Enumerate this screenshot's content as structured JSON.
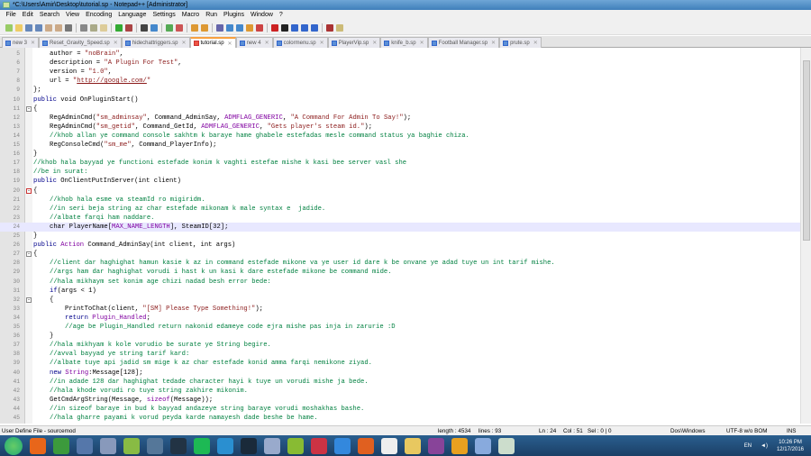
{
  "window": {
    "title": "*C:\\Users\\Amir\\Desktop\\tutorial.sp - Notepad++ [Administrator]"
  },
  "menu": [
    "File",
    "Edit",
    "Search",
    "View",
    "Encoding",
    "Language",
    "Settings",
    "Macro",
    "Run",
    "Plugins",
    "Window",
    "?"
  ],
  "tabs": [
    {
      "label": "new  3"
    },
    {
      "label": "Reset_Gravity_Speed.sp"
    },
    {
      "label": "hidechattriggers.sp"
    },
    {
      "label": "tutorial.sp",
      "active": true
    },
    {
      "label": "new  4"
    },
    {
      "label": "colormenu.sp"
    },
    {
      "label": "PlayerVip.sp"
    },
    {
      "label": "knife_b.sp"
    },
    {
      "label": "Football Manager.sp"
    },
    {
      "label": "prute.sp"
    }
  ],
  "lines": [
    {
      "n": "5",
      "i": 1,
      "seg": [
        [
          "t",
          "author = "
        ],
        [
          "s",
          "\"noBrain\""
        ],
        [
          "t",
          ","
        ]
      ]
    },
    {
      "n": "6",
      "i": 1,
      "seg": [
        [
          "t",
          "description = "
        ],
        [
          "s",
          "\"A Plugin For Test\""
        ],
        [
          "t",
          ","
        ]
      ]
    },
    {
      "n": "7",
      "i": 1,
      "seg": [
        [
          "t",
          "version = "
        ],
        [
          "s",
          "\"1.0\""
        ],
        [
          "t",
          ","
        ]
      ]
    },
    {
      "n": "8",
      "i": 1,
      "seg": [
        [
          "t",
          "url = "
        ],
        [
          "s",
          "\""
        ],
        [
          "u",
          "http://google.com/"
        ],
        [
          "s",
          "\""
        ]
      ]
    },
    {
      "n": "9",
      "i": 0,
      "seg": [
        [
          "t",
          "};"
        ]
      ]
    },
    {
      "n": "10",
      "i": 0,
      "seg": [
        [
          "k",
          "public"
        ],
        [
          "t",
          " void OnPluginStart()"
        ]
      ]
    },
    {
      "n": "11",
      "i": 0,
      "seg": [
        [
          "t",
          "{"
        ]
      ],
      "fold": "-"
    },
    {
      "n": "12",
      "i": 1,
      "seg": [
        [
          "t",
          "RegAdminCmd("
        ],
        [
          "s",
          "\"sm_adminsay\""
        ],
        [
          "t",
          ", Command_AdminSay, "
        ],
        [
          "m",
          "ADMFLAG_GENERIC"
        ],
        [
          "t",
          ", "
        ],
        [
          "s",
          "\"A Command For Admin To Say!\""
        ],
        [
          "t",
          ");"
        ]
      ]
    },
    {
      "n": "13",
      "i": 1,
      "seg": [
        [
          "t",
          "RegAdminCmd("
        ],
        [
          "s",
          "\"sm_getid\""
        ],
        [
          "t",
          ", Command_GetId, "
        ],
        [
          "m",
          "ADMFLAG_GENERIC"
        ],
        [
          "t",
          ", "
        ],
        [
          "s",
          "\"Gets player's steam id.\""
        ],
        [
          "t",
          ");"
        ]
      ]
    },
    {
      "n": "14",
      "i": 1,
      "seg": [
        [
          "c",
          "//khob allan ye command console sakhtm k baraye hame ghabele estefadas mesle command status ya baghie chiza."
        ]
      ]
    },
    {
      "n": "15",
      "i": 1,
      "seg": [
        [
          "t",
          "RegConsoleCmd("
        ],
        [
          "s",
          "\"sm_me\""
        ],
        [
          "t",
          ", Command_PlayerInfo);"
        ]
      ]
    },
    {
      "n": "16",
      "i": 0,
      "seg": [
        [
          "t",
          "}"
        ]
      ]
    },
    {
      "n": "17",
      "i": 0,
      "seg": [
        [
          "c",
          "//khob hala bayyad ye functioni estefade konim k vaghti estefae mishe k kasi bee server vasl she"
        ]
      ]
    },
    {
      "n": "18",
      "i": 0,
      "seg": [
        [
          "c",
          "//be in surat:"
        ]
      ]
    },
    {
      "n": "19",
      "i": 0,
      "seg": [
        [
          "k",
          "public"
        ],
        [
          "t",
          " OnClientPutInServer(int client)"
        ]
      ]
    },
    {
      "n": "20",
      "i": 0,
      "seg": [
        [
          "t",
          "{"
        ]
      ],
      "fold": "-r"
    },
    {
      "n": "21",
      "i": 1,
      "seg": [
        [
          "c",
          "//khob hala esme va steamId ro migiridm."
        ]
      ]
    },
    {
      "n": "22",
      "i": 1,
      "seg": [
        [
          "c",
          "//in seri beja string az char estefade mikonam k male syntax e  jadide."
        ]
      ]
    },
    {
      "n": "23",
      "i": 1,
      "seg": [
        [
          "c",
          "//albate farqi ham naddare."
        ]
      ]
    },
    {
      "n": "24",
      "i": 1,
      "cur": true,
      "seg": [
        [
          "t",
          "char PlayerName["
        ],
        [
          "m",
          "MAX_NAME_LENGTH"
        ],
        [
          "t",
          "], SteamID[32];"
        ]
      ]
    },
    {
      "n": "25",
      "i": 0,
      "seg": [
        [
          "t",
          "}"
        ]
      ]
    },
    {
      "n": "26",
      "i": 0,
      "seg": [
        [
          "k",
          "public"
        ],
        [
          "t",
          " "
        ],
        [
          "m",
          "Action"
        ],
        [
          "t",
          " Command_AdminSay(int client, int args)"
        ]
      ]
    },
    {
      "n": "27",
      "i": 0,
      "seg": [
        [
          "t",
          "{"
        ]
      ],
      "fold": "-"
    },
    {
      "n": "28",
      "i": 1,
      "seg": [
        [
          "c",
          "//client dar haghighat hamun kasie k az in command estefade mikone va ye user id dare k be onvane ye adad tuye un int tarif mishe."
        ]
      ]
    },
    {
      "n": "29",
      "i": 1,
      "seg": [
        [
          "c",
          "//args ham dar haghighat vorudi i hast k un kasi k dare estefade mikone be command mide."
        ]
      ]
    },
    {
      "n": "30",
      "i": 1,
      "seg": [
        [
          "c",
          "//hala mikhaym set konim age chizi nadad besh error bede:"
        ]
      ]
    },
    {
      "n": "31",
      "i": 1,
      "seg": [
        [
          "k",
          "if"
        ],
        [
          "t",
          "(args < 1)"
        ]
      ]
    },
    {
      "n": "32",
      "i": 1,
      "seg": [
        [
          "t",
          "{"
        ]
      ],
      "fold": "-"
    },
    {
      "n": "33",
      "i": 2,
      "seg": [
        [
          "t",
          "PrintToChat(client, "
        ],
        [
          "s",
          "\"[SM] Please Type Something!\""
        ],
        [
          "t",
          ");"
        ]
      ]
    },
    {
      "n": "34",
      "i": 2,
      "seg": [
        [
          "k",
          "return"
        ],
        [
          "t",
          " "
        ],
        [
          "m",
          "Plugin_Handled"
        ],
        [
          "t",
          ";"
        ]
      ]
    },
    {
      "n": "35",
      "i": 2,
      "seg": [
        [
          "c",
          "//age be Plugin_Handled return nakonid edameye code ejra mishe pas inja in zarurie :D"
        ]
      ]
    },
    {
      "n": "36",
      "i": 1,
      "seg": [
        [
          "t",
          "}"
        ]
      ]
    },
    {
      "n": "37",
      "i": 1,
      "seg": [
        [
          "c",
          "//hala mikhyam k kole vorudio be surate ye String begire."
        ]
      ]
    },
    {
      "n": "38",
      "i": 1,
      "seg": [
        [
          "c",
          "//avval bayyad ye string tarif kard:"
        ]
      ]
    },
    {
      "n": "39",
      "i": 1,
      "seg": [
        [
          "c",
          "//albate tuye api jadid sm mige k az char estefade konid amma farqi nemikone ziyad."
        ]
      ]
    },
    {
      "n": "40",
      "i": 1,
      "seg": [
        [
          "k",
          "new"
        ],
        [
          "t",
          " "
        ],
        [
          "m",
          "String"
        ],
        [
          "t",
          ":Message[128];"
        ]
      ]
    },
    {
      "n": "41",
      "i": 1,
      "seg": [
        [
          "c",
          "//in adade 128 dar haghighat tedade character hayi k tuye un vorudi mishe ja bede."
        ]
      ]
    },
    {
      "n": "42",
      "i": 1,
      "seg": [
        [
          "c",
          "//hala khode vorudi ro tuye string zakhire mikonim."
        ]
      ]
    },
    {
      "n": "43",
      "i": 1,
      "seg": [
        [
          "t",
          "GetCmdArgString(Message, "
        ],
        [
          "m",
          "sizeof"
        ],
        [
          "t",
          "(Message));"
        ]
      ]
    },
    {
      "n": "44",
      "i": 1,
      "seg": [
        [
          "c",
          "//in sizeof baraye in bud k bayyad andazeye string baraye vorudi moshakhas bashe."
        ]
      ]
    },
    {
      "n": "45",
      "i": 1,
      "seg": [
        [
          "c",
          "//hala gharre payami k vorud peyda karde namayesh dade beshe be hame."
        ]
      ]
    }
  ],
  "status": {
    "lang": "User Define File - sourcemod",
    "length": "length : 4534",
    "lines": "lines : 93",
    "ln": "Ln : 24",
    "col": "Col : 51",
    "sel": "Sel : 0 | 0",
    "eol": "Dos\\Windows",
    "enc": "UTF-8 w/o BOM",
    "mode": "INS"
  },
  "taskbar": {
    "apps": [
      {
        "name": "firefox",
        "color": "#e8661a"
      },
      {
        "name": "chrome",
        "color": "#3c9a3c"
      },
      {
        "name": "network",
        "color": "#5577aa"
      },
      {
        "name": "tool",
        "color": "#8899bb"
      },
      {
        "name": "notepad-plus-plus",
        "color": "#88bb44"
      },
      {
        "name": "media",
        "color": "#557799"
      },
      {
        "name": "steam",
        "color": "#223344"
      },
      {
        "name": "spotify",
        "color": "#1db954"
      },
      {
        "name": "telegram",
        "color": "#2a8fd0"
      },
      {
        "name": "steam-2",
        "color": "#1a2a3a"
      },
      {
        "name": "agent",
        "color": "#99aacc"
      },
      {
        "name": "bluestacks",
        "color": "#88bb33"
      },
      {
        "name": "app",
        "color": "#cc3344"
      },
      {
        "name": "shark",
        "color": "#3388dd"
      },
      {
        "name": "recorder",
        "color": "#e06020"
      },
      {
        "name": "vc",
        "color": "#eeeeee"
      },
      {
        "name": "explorer",
        "color": "#e8c860"
      },
      {
        "name": "winrar",
        "color": "#884499"
      },
      {
        "name": "office",
        "color": "#e8a020"
      },
      {
        "name": "notes",
        "color": "#88aadd"
      },
      {
        "name": "window",
        "color": "#ccddcc"
      }
    ],
    "lang": "EN",
    "time": "10:26 PM",
    "date": "12/17/2016"
  }
}
